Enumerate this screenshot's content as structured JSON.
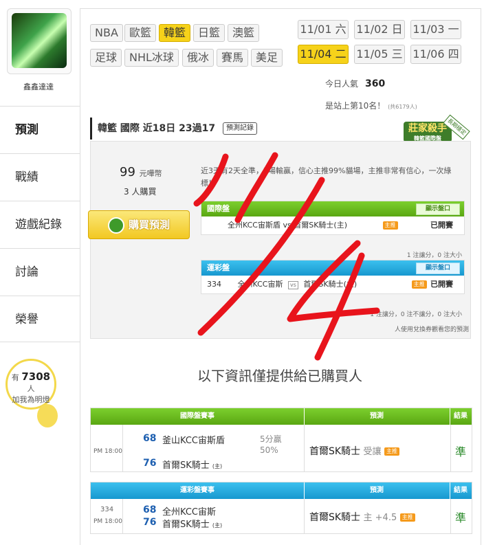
{
  "sidebar": {
    "username": "鑫鑫達達",
    "nav": [
      "預測",
      "戰績",
      "遊戲紀錄",
      "討論",
      "榮譽"
    ],
    "fans": {
      "prefix": "有",
      "count": "7308",
      "suffix": "人",
      "cta": "加我為明燈"
    }
  },
  "sports_tabs": [
    "NBA",
    "歐籃",
    "韓籃",
    "日籃",
    "澳籃",
    "足球",
    "NHL冰球",
    "俄冰",
    "賽馬",
    "美足"
  ],
  "active_sport": "韓籃",
  "dates": [
    {
      "md": "11/01",
      "dow": "六"
    },
    {
      "md": "11/02",
      "dow": "日"
    },
    {
      "md": "11/03",
      "dow": "一"
    },
    {
      "md": "11/04",
      "dow": "二"
    },
    {
      "md": "11/05",
      "dow": "三"
    },
    {
      "md": "11/06",
      "dow": "四"
    }
  ],
  "active_date": "11/04",
  "stats": {
    "popularity_label": "今日人氣",
    "popularity_value": "360",
    "rank_text": "是站上第10名！",
    "rank_total": "(共6179人)"
  },
  "prediction": {
    "header_text": "韓籃 國際 近18日 23過17",
    "record_button": "預測記錄",
    "badge_title": "莊家殺手",
    "badge_sub": "韓籃國際盤",
    "badge_ribbon": "長期穩定",
    "price": "99",
    "price_unit": "元嘩幣",
    "buyers": "3 人購買",
    "buy_button": "購買預測",
    "description": "近3天有2天全準，2場輸贏，信心主推99%貓場，主推非常有信心，一次綠標！",
    "intl": {
      "title": "國際盤",
      "show_button": "顯示盤口",
      "match": "全州KCC宙斯盾 vs 首爾SK騎士(主)",
      "tag": "主推",
      "status": "已開賽",
      "note": "1 注讓分，0 注大小"
    },
    "sports_lottery": {
      "title": "運彩盤",
      "show_button": "顯示盤口",
      "game_no": "334",
      "home": "全州KCC宙斯",
      "away": "首爾SK騎士(主)",
      "vs": "vs",
      "tag": "主推",
      "status": "已開賽",
      "note": "1 注讓分，0 注不讓分，0 注大小"
    },
    "coupon_note": "人使用兌換券觀看您的預測"
  },
  "info_message": "以下資訊僅提供給已購買人",
  "results": {
    "intl": {
      "headers": [
        "國際盤賽事",
        "預測",
        "結果"
      ],
      "time": "PM 18:00",
      "team1_score": "68",
      "team1": "釜山KCC宙斯盾",
      "team2_score": "76",
      "team2": "首爾SK騎士",
      "team2_tag": "(主)",
      "handicap": "5分贏",
      "handicap_pct": "50%",
      "pick": "首爾SK騎士",
      "pick_note": "受讓",
      "pick_tag": "主推",
      "result": "準"
    },
    "lottery": {
      "headers": [
        "運彩盤賽事",
        "預測",
        "結果"
      ],
      "game_no": "334",
      "time": "PM 18:00",
      "team1_score": "68",
      "team1": "全州KCC宙斯",
      "team2_score": "76",
      "team2": "首爾SK騎士",
      "team2_tag": "(主)",
      "pick": "首爾SK騎士",
      "pick_note": "主 +4.5",
      "pick_tag": "主推",
      "result": "準"
    }
  },
  "overlay_text": "11/4",
  "colors": {
    "accent_yellow": "#f6d21a",
    "green_head": "#5aa712",
    "blue_head": "#1798cf",
    "marker_red": "#e8141c"
  }
}
